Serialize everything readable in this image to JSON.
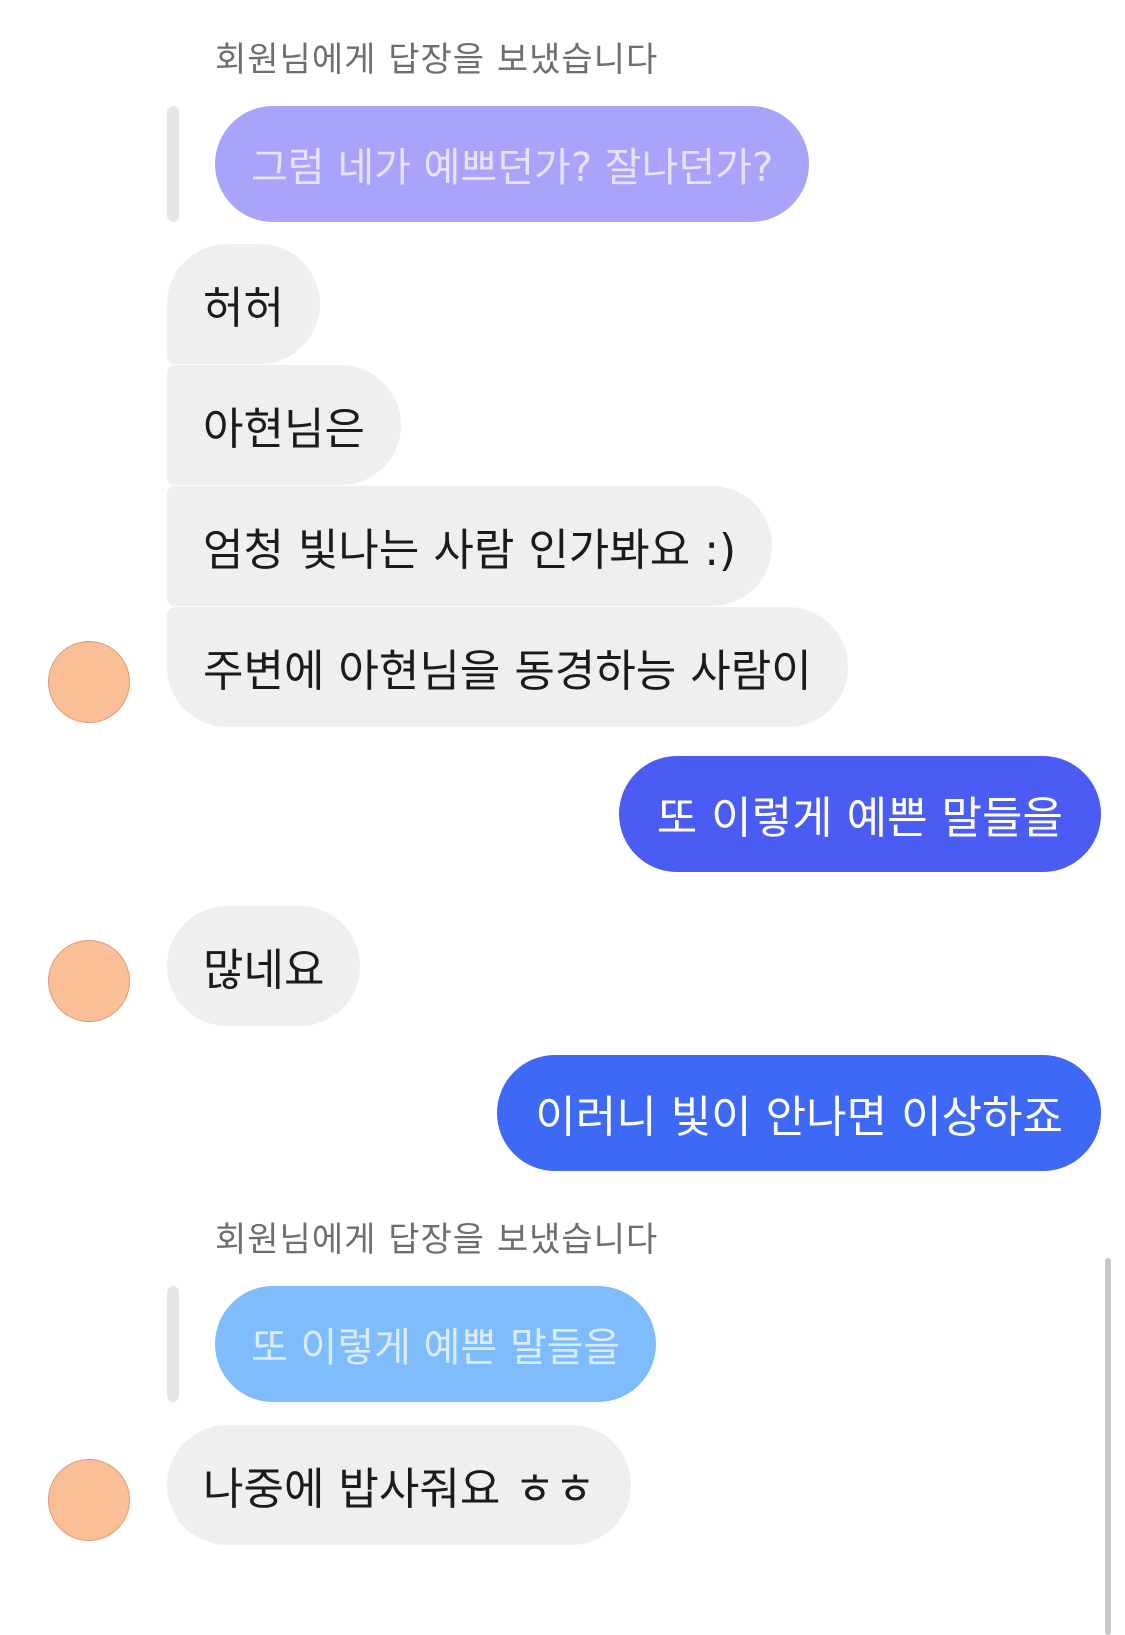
{
  "colors": {
    "incoming_bubble": "#efefef",
    "outgoing_bubble_1": "#4a5cf3",
    "outgoing_bubble_2": "#3e69f6",
    "quoted_bubble_1": "#aaa3fa",
    "quoted_bubble_2": "#7fbcfb",
    "avatar": "#fbbf98"
  },
  "reply_1": {
    "label": "회원님에게 답장을 보냈습니다",
    "quoted_text": "그럼 네가 예쁘던가? 잘나던가?"
  },
  "group_1": {
    "msg_1": "허허",
    "msg_2": "아현님은",
    "msg_3": "엄청 빛나는 사람 인가봐요 :)",
    "msg_4": "주변에 아현님을 동경하능 사람이",
    "avatar_icon": "profile-avatar-icon"
  },
  "outgoing_1": {
    "text": "또 이렇게 예쁜 말들을"
  },
  "group_2": {
    "msg_1": "많네요",
    "avatar_icon": "profile-avatar-icon"
  },
  "outgoing_2": {
    "text": "이러니 빛이 안나면 이상하죠"
  },
  "reply_2": {
    "label": "회원님에게 답장을 보냈습니다",
    "quoted_text": "또 이렇게 예쁜 말들을"
  },
  "group_3": {
    "msg_1": "나중에 밥사줘요 ㅎㅎ",
    "avatar_icon": "profile-avatar-icon"
  }
}
